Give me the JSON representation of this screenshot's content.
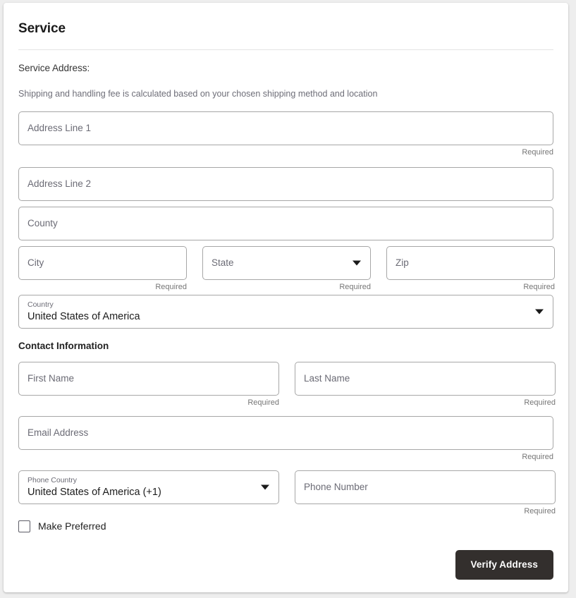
{
  "card": {
    "title": "Service",
    "section_label": "Service Address:",
    "hint": "Shipping and handling fee is calculated based on your chosen shipping method and location",
    "contact_heading": "Contact Information"
  },
  "labels": {
    "required": "Required"
  },
  "fields": {
    "address_line_1": {
      "placeholder": "Address Line 1",
      "value": "",
      "required_text": "Required"
    },
    "address_line_2": {
      "placeholder": "Address Line 2",
      "value": "",
      "required_text": ""
    },
    "county": {
      "placeholder": "County",
      "value": "",
      "required_text": ""
    },
    "city": {
      "placeholder": "City",
      "value": "",
      "required_text": "Required"
    },
    "state": {
      "placeholder": "State",
      "value": "",
      "required_text": "Required",
      "icon": "chevron-down-icon"
    },
    "zip": {
      "placeholder": "Zip",
      "value": "",
      "required_text": "Required"
    },
    "country": {
      "label": "Country",
      "value": "United States of America",
      "required_text": "",
      "icon": "chevron-down-icon"
    },
    "first_name": {
      "placeholder": "First Name",
      "value": "",
      "required_text": "Required"
    },
    "last_name": {
      "placeholder": "Last Name",
      "value": "",
      "required_text": "Required"
    },
    "email_address": {
      "placeholder": "Email Address",
      "value": "",
      "required_text": "Required"
    },
    "phone_country": {
      "label": "Phone Country",
      "value": "United States of America (+1)",
      "required_text": "",
      "icon": "chevron-down-icon"
    },
    "phone_number": {
      "placeholder": "Phone Number",
      "value": "",
      "required_text": "Required"
    }
  },
  "checkbox": {
    "label": "Make Preferred",
    "checked": false
  },
  "button": {
    "verify_address_label": "Verify Address"
  },
  "colors": {
    "button_bg": "#332F2D",
    "button_text": "#FFFFFF",
    "field_border": "#A7A7A7",
    "placeholder_text": "#6B6B75",
    "helper_text": "#767676",
    "card_bg": "#FFFFFF",
    "page_bg": "#EEEEEE"
  }
}
